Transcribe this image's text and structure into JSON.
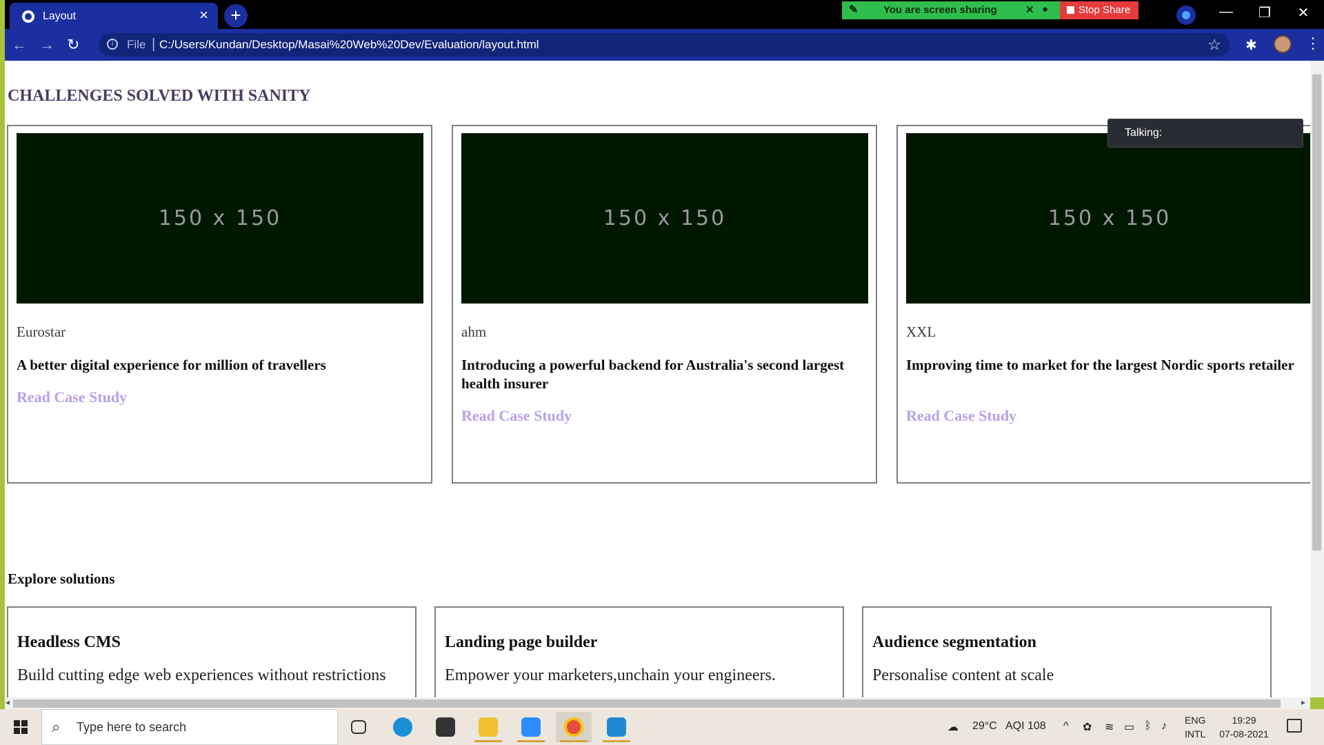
{
  "browser": {
    "tab_title": "Layout",
    "tab_close": "×",
    "new_tab": "+",
    "url_scheme": "File",
    "url_separator": "|",
    "url": "C:/Users/Kundan/Desktop/Masai%20Web%20Dev/Evaluation/layout.html",
    "back_icon": "←",
    "forward_icon": "→",
    "reload_icon": "↻",
    "star_icon": "☆",
    "extensions_icon": "✱",
    "menu_icon": "⋮",
    "window_minimize": "—",
    "window_restore": "❐",
    "window_close": "✕"
  },
  "screen_share": {
    "message": "You are screen sharing",
    "stop_label": "Stop Share",
    "talking_label": "Talking:"
  },
  "page": {
    "challenges_heading": "CHALLENGES SOLVED WITH SANITY",
    "placeholder_label": "150 x 150",
    "cards": [
      {
        "brand": "Eurostar",
        "headline": "A better digital experience for million of travellers",
        "link": "Read Case Study"
      },
      {
        "brand": "ahm",
        "headline": "Introducing a powerful backend for Australia's second largest health insurer",
        "link": "Read Case Study"
      },
      {
        "brand": "XXL",
        "headline": "Improving time to market for the largest Nordic sports retailer",
        "link": "Read Case Study"
      }
    ],
    "explore_heading": "Explore solutions",
    "solutions": [
      {
        "title": "Headless CMS",
        "desc": "Build cutting edge web experiences without restrictions"
      },
      {
        "title": "Landing page builder",
        "desc": "Empower your marketers,unchain your engineers."
      },
      {
        "title": "Audience segmentation",
        "desc": "Personalise content at scale"
      }
    ]
  },
  "taskbar": {
    "search_placeholder": "Type here to search",
    "weather": "29°C",
    "aqi": "AQI 108",
    "lang_top": "ENG",
    "lang_bottom": "INTL",
    "time": "19:29",
    "date": "07-08-2021"
  },
  "colors": {
    "browser_accent": "#1b2fa0",
    "share_green": "#2fbe4e",
    "stop_red": "#e63b3b",
    "link_purple": "#b9a0e8",
    "placeholder_bg": "#001800"
  }
}
